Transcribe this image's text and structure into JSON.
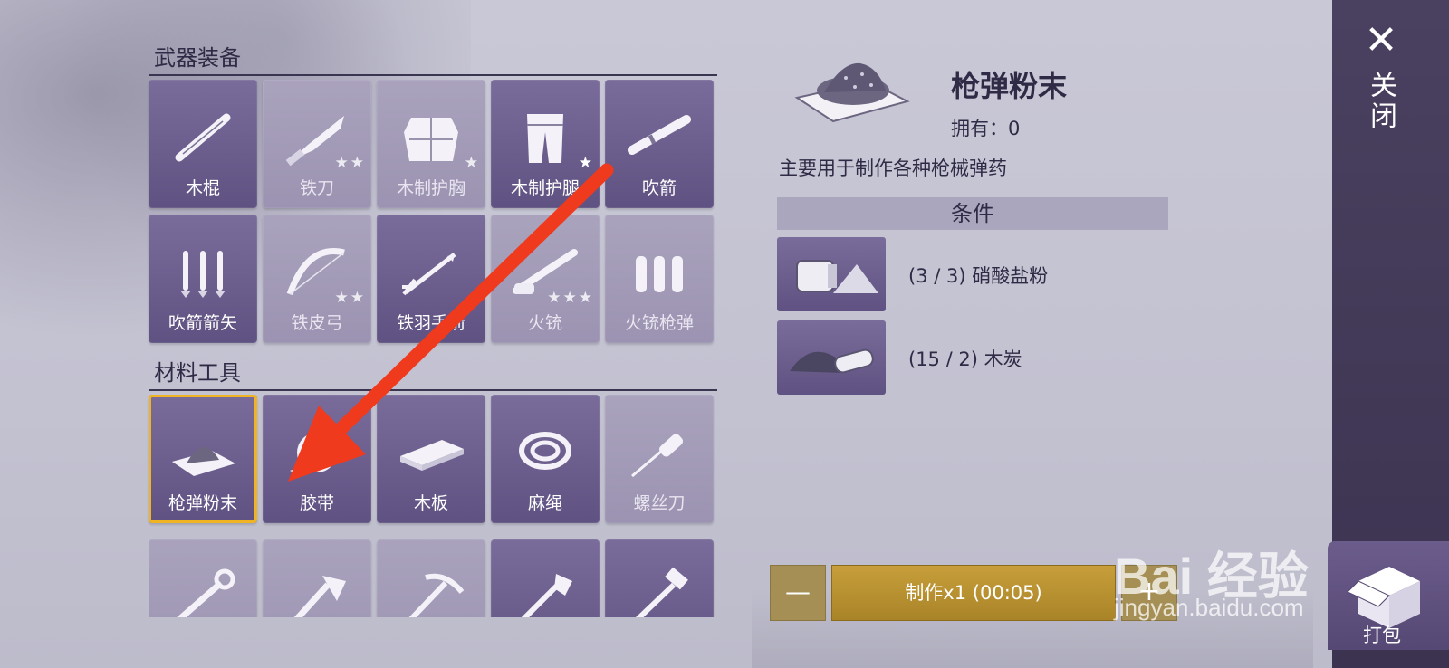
{
  "sections": {
    "weapons_title": "武器装备",
    "materials_title": "材料工具"
  },
  "weapons": [
    {
      "label": "木棍",
      "stars": "",
      "state": "active",
      "icon": "stick-icon"
    },
    {
      "label": "铁刀",
      "stars": "★★",
      "state": "dim",
      "icon": "knife-icon"
    },
    {
      "label": "木制护胸",
      "stars": "★",
      "state": "dim",
      "icon": "chest-armor-icon"
    },
    {
      "label": "木制护腿",
      "stars": "★",
      "state": "active",
      "icon": "leg-armor-icon"
    },
    {
      "label": "吹箭",
      "stars": "",
      "state": "active",
      "icon": "blowgun-icon"
    },
    {
      "label": "吹箭箭矢",
      "stars": "",
      "state": "active",
      "icon": "darts-icon"
    },
    {
      "label": "铁皮弓",
      "stars": "★★",
      "state": "dim",
      "icon": "bow-icon"
    },
    {
      "label": "铁羽手箭",
      "stars": "",
      "state": "active",
      "icon": "arrow-icon"
    },
    {
      "label": "火铳",
      "stars": "★★★",
      "state": "dim",
      "icon": "musket-icon"
    },
    {
      "label": "火铳枪弹",
      "stars": "",
      "state": "dim",
      "icon": "bullets-icon"
    }
  ],
  "materials": [
    {
      "label": "枪弹粉末",
      "stars": "",
      "state": "selected",
      "icon": "powder-icon"
    },
    {
      "label": "胶带",
      "stars": "",
      "state": "active",
      "icon": "tape-icon"
    },
    {
      "label": "木板",
      "stars": "",
      "state": "active",
      "icon": "plank-icon"
    },
    {
      "label": "麻绳",
      "stars": "",
      "state": "active",
      "icon": "rope-icon"
    },
    {
      "label": "螺丝刀",
      "stars": "",
      "state": "dim",
      "icon": "screwdriver-icon"
    }
  ],
  "tools_row": [
    {
      "state": "dim",
      "icon": "wrench-icon"
    },
    {
      "state": "dim",
      "icon": "axe-icon"
    },
    {
      "state": "dim",
      "icon": "pickaxe-icon"
    },
    {
      "state": "active",
      "icon": "stone-axe-icon"
    },
    {
      "state": "active",
      "icon": "stone-hammer-icon"
    }
  ],
  "detail": {
    "name": "枪弹粉末",
    "owned": "拥有：0",
    "description": "主要用于制作各种枪械弹药",
    "conditions_header": "条件",
    "materials": [
      {
        "text": "(3 / 3) 硝酸盐粉",
        "icon": "nitrate-powder-icon"
      },
      {
        "text": "(15 / 2) 木炭",
        "icon": "charcoal-icon"
      }
    ]
  },
  "craft": {
    "minus": "—",
    "button": "制作x1 (00:05)",
    "plus": "+"
  },
  "side": {
    "close_label": "关闭",
    "pack_label": "打包"
  },
  "watermark": {
    "main": "Bai 经验",
    "sub": "jingyan.baidu.com"
  },
  "colors": {
    "tile_active": "#6b5d8e",
    "tile_dim": "#a39cb8",
    "selected_outline": "#f0b323",
    "craft_button": "#b8922f",
    "annotation_arrow": "#ef3a1d"
  }
}
